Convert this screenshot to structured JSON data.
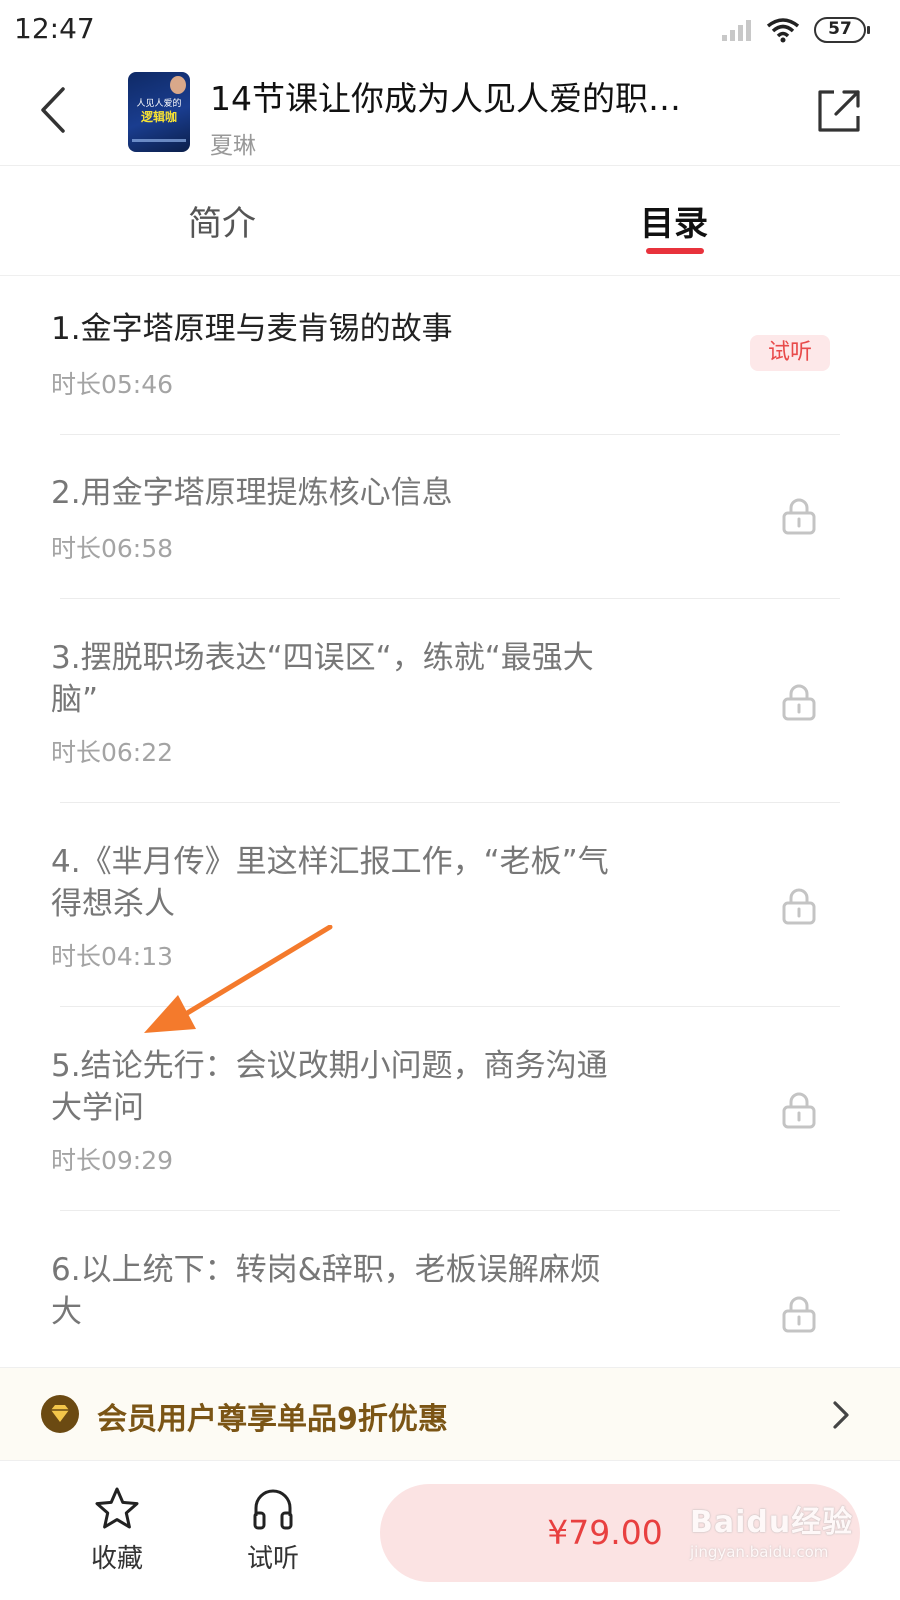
{
  "status_bar": {
    "time": "12:47",
    "battery": "57"
  },
  "header": {
    "cover_text_line1": "人见人爱的",
    "cover_text_line2": "逻辑咖",
    "course_title": "14节课让你成为人见人爱的职…",
    "author": "夏琳"
  },
  "tabs": [
    {
      "label": "简介",
      "active": false
    },
    {
      "label": "目录",
      "active": true
    }
  ],
  "lessons": [
    {
      "title": "1.金字塔原理与麦肯锡的故事",
      "duration": "时长05:46",
      "badge": "试听",
      "locked": false
    },
    {
      "title": "2.用金字塔原理提炼核心信息",
      "duration": "时长06:58",
      "locked": true
    },
    {
      "title": "3.摆脱职场表达“四误区“，练就“最强大脑”",
      "duration": "时长06:22",
      "locked": true
    },
    {
      "title": "4.《芈月传》里这样汇报工作，“老板”气得想杀人",
      "duration": "时长04:13",
      "locked": true
    },
    {
      "title": "5.结论先行：会议改期小问题，商务沟通大学问",
      "duration": "时长09:29",
      "locked": true
    },
    {
      "title": "6.以上统下：转岗&辞职，老板误解麻烦大",
      "locked": true
    }
  ],
  "member_bar": {
    "text": "会员用户尊享单品9折优惠"
  },
  "bottom_bar": {
    "favorite_label": "收藏",
    "listen_label": "试听",
    "price": "¥79.00"
  },
  "watermark": {
    "brand": "Baidu经验",
    "url": "jingyan.baidu.com"
  },
  "colors": {
    "accent": "#e8323c",
    "member_text": "#7b5515",
    "buy_button_bg": "#fbe3e3"
  }
}
